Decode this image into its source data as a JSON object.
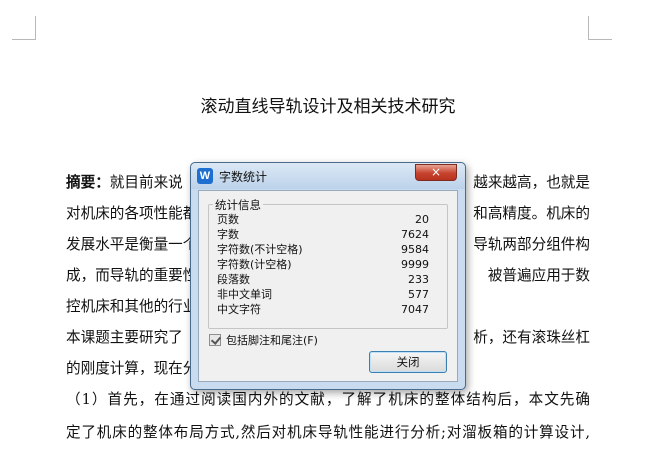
{
  "document": {
    "title": "滚动直线导轨设计及相关技术研究",
    "lines": [
      {
        "bold": "摘要：",
        "text": "就目前来说",
        "tail": "越来越高，也就是"
      },
      {
        "text": "对机床的各项性能都有",
        "tail": "和高精度。机床的"
      },
      {
        "text": "发展水平是衡量一个国",
        "tail": "导轨两部分组件构"
      },
      {
        "text": "成，而导轨的重要性要",
        "tail": "被普遍应用于数"
      },
      {
        "text": "控机床和其他的行业中",
        "tail": ""
      },
      {
        "text": "本课题主要研究了",
        "tail": "析，还有滚珠丝杠"
      },
      {
        "text": "的刚度计算，现在分别",
        "tail": ""
      },
      {
        "text": "（1）首先，在通过阅读国内外的文献，了解了机床的整体结构后，本文先确"
      },
      {
        "text": "定了机床的整体布局方式,然后对机床导轨性能进行分析;对溜板箱的计算设计,"
      }
    ]
  },
  "dialog": {
    "title": "字数统计",
    "app_icon": "W",
    "close_label": "×",
    "group_label": "统计信息",
    "stats": [
      {
        "label": "页数",
        "value": "20"
      },
      {
        "label": "字数",
        "value": "7624"
      },
      {
        "label": "字符数(不计空格)",
        "value": "9584"
      },
      {
        "label": "字符数(计空格)",
        "value": "9999"
      },
      {
        "label": "段落数",
        "value": "233"
      },
      {
        "label": "非中文单词",
        "value": "577"
      },
      {
        "label": "中文字符",
        "value": "7047"
      }
    ],
    "checkbox_label": "包括脚注和尾注(F)",
    "checkbox_checked": true,
    "ok_label": "关闭"
  }
}
